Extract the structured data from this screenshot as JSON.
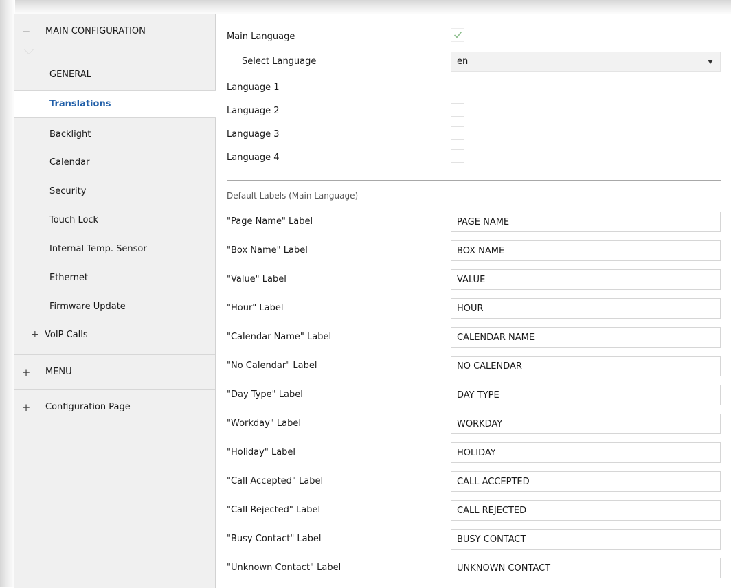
{
  "sidebar": {
    "main_configuration": {
      "glyph": "−",
      "label": "MAIN CONFIGURATION"
    },
    "items": [
      {
        "label": "GENERAL"
      },
      {
        "label": "Translations",
        "selected": true
      },
      {
        "label": "Backlight"
      },
      {
        "label": "Calendar"
      },
      {
        "label": "Security"
      },
      {
        "label": "Touch Lock"
      },
      {
        "label": "Internal Temp. Sensor"
      },
      {
        "label": "Ethernet"
      },
      {
        "label": "Firmware Update"
      },
      {
        "label": "VoIP Calls",
        "expander": "+"
      }
    ],
    "menu": {
      "glyph": "+",
      "label": "MENU"
    },
    "configuration_page": {
      "glyph": "+",
      "label": "Configuration Page"
    }
  },
  "languages": {
    "main_language": {
      "label": "Main Language",
      "checked": true
    },
    "select_language": {
      "label": "Select Language",
      "value": "en"
    },
    "language_1": {
      "label": "Language 1",
      "checked": false
    },
    "language_2": {
      "label": "Language 2",
      "checked": false
    },
    "language_3": {
      "label": "Language 3",
      "checked": false
    },
    "language_4": {
      "label": "Language 4",
      "checked": false
    }
  },
  "default_labels": {
    "heading": "Default Labels (Main Language)",
    "fields": [
      {
        "label": "\"Page Name\" Label",
        "value": "PAGE NAME"
      },
      {
        "label": "\"Box Name\" Label",
        "value": "BOX NAME"
      },
      {
        "label": "\"Value\" Label",
        "value": "VALUE"
      },
      {
        "label": "\"Hour\" Label",
        "value": "HOUR"
      },
      {
        "label": "\"Calendar Name\" Label",
        "value": "CALENDAR NAME"
      },
      {
        "label": "\"No Calendar\" Label",
        "value": "NO CALENDAR"
      },
      {
        "label": "\"Day Type\" Label",
        "value": "DAY TYPE"
      },
      {
        "label": "\"Workday\" Label",
        "value": "WORKDAY"
      },
      {
        "label": "\"Holiday\" Label",
        "value": "HOLIDAY"
      },
      {
        "label": "\"Call Accepted\" Label",
        "value": "CALL ACCEPTED"
      },
      {
        "label": "\"Call Rejected\" Label",
        "value": "CALL REJECTED"
      },
      {
        "label": "\"Busy Contact\" Label",
        "value": "BUSY CONTACT"
      },
      {
        "label": "\"Unknown Contact\" Label",
        "value": "UNKNOWN CONTACT"
      }
    ]
  },
  "colors": {
    "selected_text": "#1f5ea8",
    "sidebar_bg": "#f0f0f0",
    "checkmark": "#8fbf8f"
  },
  "icons": {
    "checkmark": "check-icon",
    "dropdown": "chevron-down-icon",
    "collapse": "minus-icon",
    "expand": "plus-icon"
  }
}
